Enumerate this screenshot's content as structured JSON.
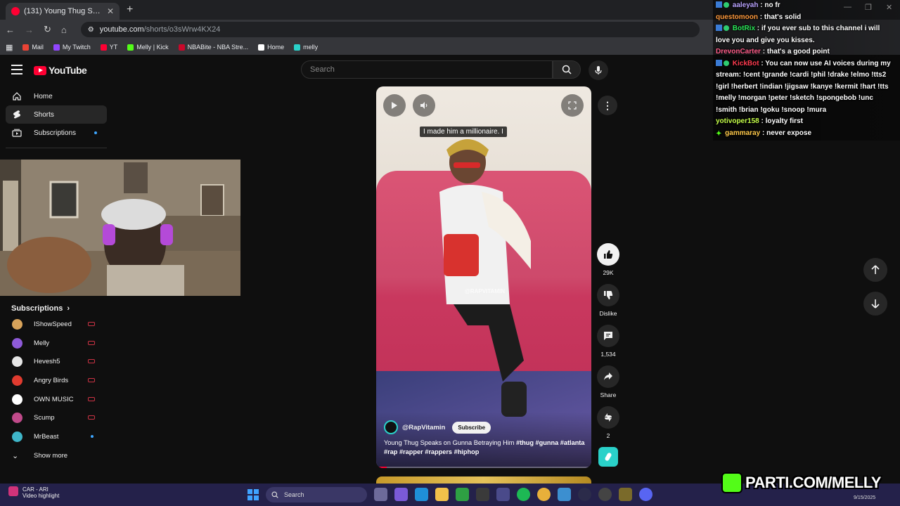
{
  "browser": {
    "tab_title": "(131) Young Thug Speaks on G",
    "url_host": "youtube.com",
    "url_path": "/shorts/o3sWrw4KX24",
    "bookmarks": [
      {
        "label": "Mail",
        "color": "#ea4335"
      },
      {
        "label": "My Twitch",
        "color": "#9146ff"
      },
      {
        "label": "YT",
        "color": "#ff0033"
      },
      {
        "label": "Melly | Kick",
        "color": "#53fc18"
      },
      {
        "label": "NBABite - NBA Stre...",
        "color": "#c9082a"
      },
      {
        "label": "Home",
        "color": "#ffffff"
      },
      {
        "label": "melly",
        "color": "#2ad1c9"
      }
    ]
  },
  "youtube": {
    "logo": "YouTube",
    "search_placeholder": "Search",
    "nav": [
      {
        "label": "Home",
        "icon": "home-icon"
      },
      {
        "label": "Shorts",
        "icon": "shorts-icon"
      },
      {
        "label": "Subscriptions",
        "icon": "subscriptions-icon"
      }
    ],
    "subscriptions_heading": "Subscriptions",
    "subscriptions": [
      {
        "name": "IShowSpeed",
        "color": "#d8a35a",
        "live": true
      },
      {
        "name": "Melly",
        "color": "#8e5ad8",
        "live": true
      },
      {
        "name": "Hevesh5",
        "color": "#e6e6e6",
        "live": true
      },
      {
        "name": "Angry Birds",
        "color": "#e03b2f",
        "live": true
      },
      {
        "name": "OWN MUSIC",
        "color": "#ffffff",
        "live": true
      },
      {
        "name": "Scump",
        "color": "#c04a8a",
        "live": true
      },
      {
        "name": "MrBeast",
        "color": "#3fb6c9",
        "live": false
      }
    ],
    "show_more": "Show more"
  },
  "short": {
    "caption": "I made him a millionaire. I",
    "watermark": "@RAPVITAMIN",
    "channel": "@RapVitamin",
    "subscribe_label": "Subscribe",
    "title": "Young Thug Speaks on Gunna Betraying Him",
    "hashtags": "#thug #gunna #atlanta #rap #rapper #rappers #hiphop",
    "progress": 0.05,
    "likes": "29K",
    "dislike_label": "Dislike",
    "comments": "1,534",
    "share_label": "Share",
    "remix_count": "2"
  },
  "chat": [
    {
      "user": "aaleyah",
      "text": "no fr",
      "color": "u1",
      "badge": "blue"
    },
    {
      "user": "questomoon",
      "text": "that's solid",
      "color": "u2",
      "badge": ""
    },
    {
      "user": "BotRix",
      "text": "if you ever sub to this channel i will love you and give you kisses.",
      "color": "u3",
      "badge": "bot"
    },
    {
      "user": "DrevonCarter",
      "text": "that's a good point",
      "color": "u4",
      "badge": ""
    },
    {
      "user": "KickBot",
      "text": "You can now use AI voices during my stream: !cent !grande !cardi !phil !drake !elmo !tts2 !girl !herbert !indian !jigsaw !kanye !kermit !hart !tts !melly !morgan !peter !sketch !spongebob !unc !smith !brian !goku !snoop !mura",
      "color": "u5",
      "badge": "bot"
    },
    {
      "user": "yotivoper158",
      "text": "loyalty first",
      "color": "u6",
      "badge": ""
    },
    {
      "user": "gammaray",
      "text": "never expose",
      "color": "u7",
      "badge": "star"
    }
  ],
  "taskbar": {
    "media_title": "CAR - ARI",
    "media_subtitle": "Video highlight",
    "search_label": "Search",
    "date": "9/15/2025"
  },
  "overlay_brand": "PARTI.COM/MELLY"
}
